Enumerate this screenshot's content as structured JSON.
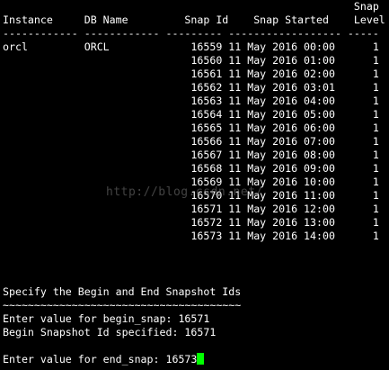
{
  "colors": {
    "background": "#000000",
    "foreground": "#ffffff",
    "cursor": "#00ff00"
  },
  "report": {
    "header_top": "                                                        Snap",
    "header": "Instance     DB Name         Snap Id    Snap Started    Level",
    "separator": "------------ ------------ --------- ------------------ -----",
    "rows": [
      "orcl         ORCL             16559 11 May 2016 00:00      1",
      "                              16560 11 May 2016 01:00      1",
      "                              16561 11 May 2016 02:00      1",
      "                              16562 11 May 2016 03:01      1",
      "                              16563 11 May 2016 04:00      1",
      "                              16564 11 May 2016 05:00      1",
      "                              16565 11 May 2016 06:00      1",
      "                              16566 11 May 2016 07:00      1",
      "                              16567 11 May 2016 08:00      1",
      "                              16568 11 May 2016 09:00      1",
      "                              16569 11 May 2016 10:00      1",
      "                              16570 11 May 2016 11:00      1",
      "                              16571 11 May 2016 12:00      1",
      "                              16572 11 May 2016 13:00      1",
      "                              16573 11 May 2016 14:00      1"
    ]
  },
  "prompt": {
    "specify": "Specify the Begin and End Snapshot Ids",
    "tilde_line": "~~~~~~~~~~~~~~~~~~~~~~~~~~~~~~~~~~~~~~",
    "begin_prompt": "Enter value for begin_snap: 16571",
    "begin_confirm": "Begin Snapshot Id specified: 16571",
    "end_prompt": "Enter value for end_snap: 16573"
  },
  "watermark": "http://blog.csdn.net/"
}
